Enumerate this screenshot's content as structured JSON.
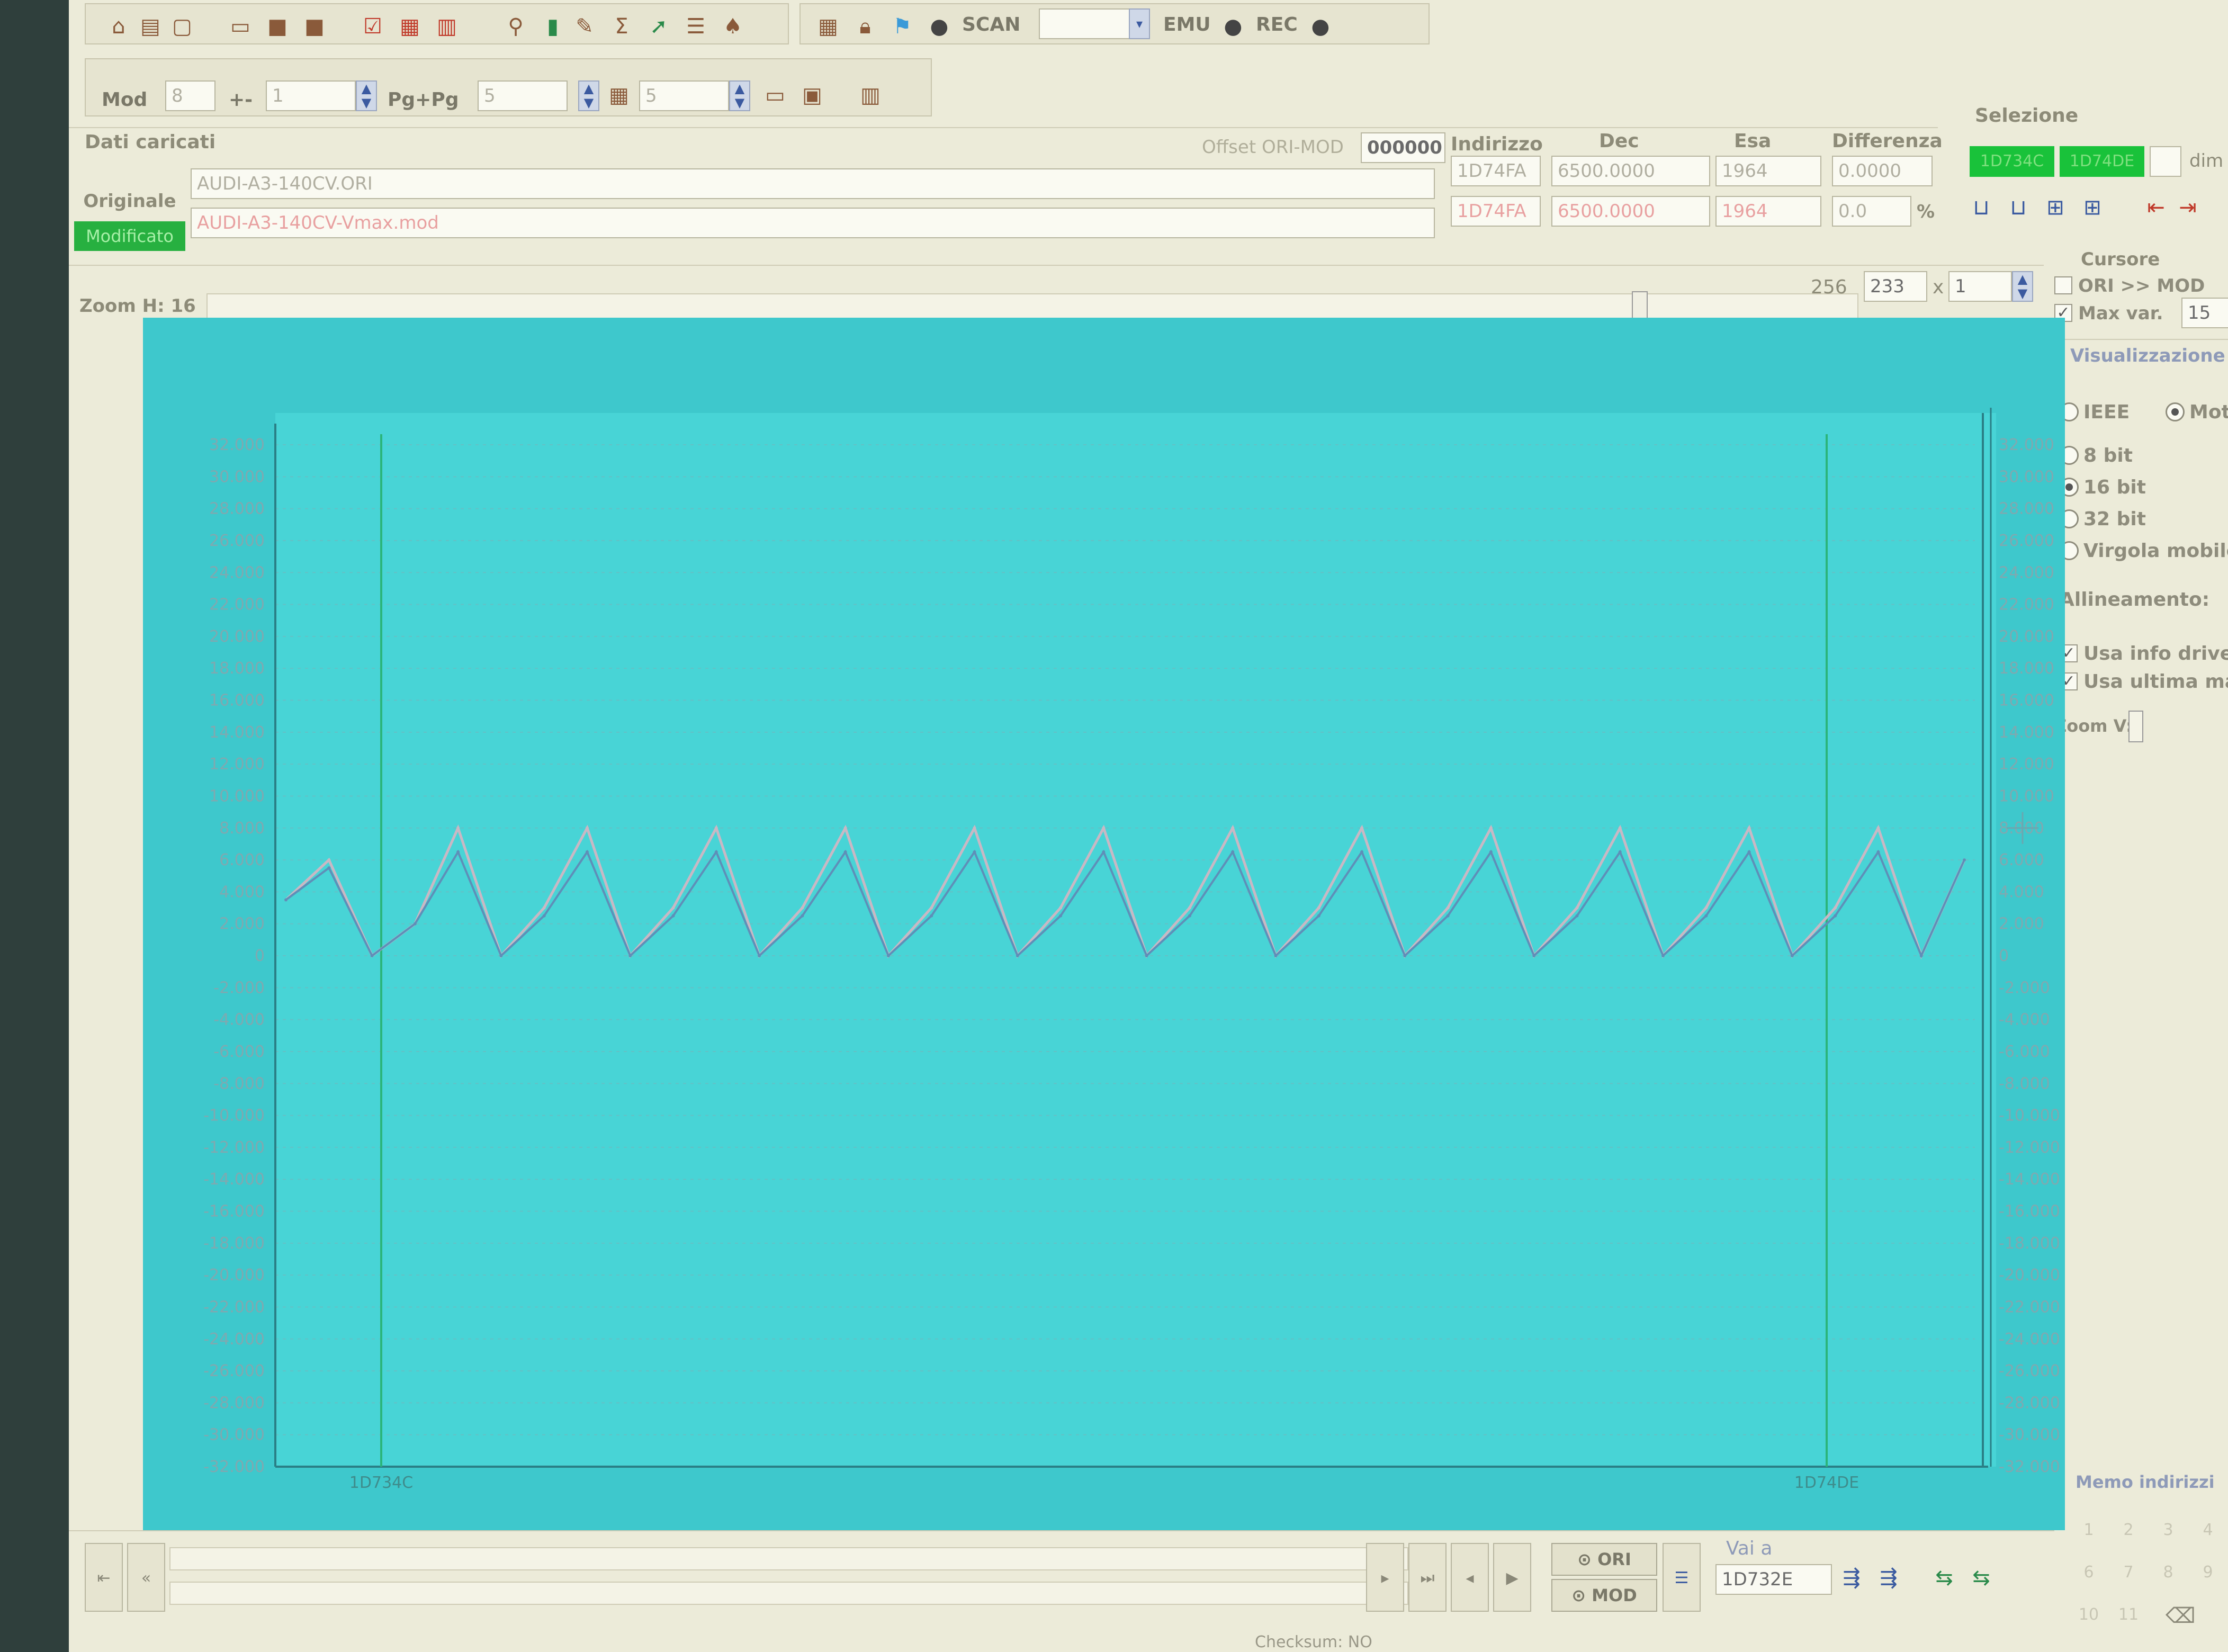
{
  "toolbar": {
    "scan_label": "SCAN",
    "emu_label": "EMU",
    "rec_label": "REC"
  },
  "toolbar2": {
    "mod_label": "Mod",
    "mod_value": "8",
    "plusminus_label": "+-",
    "plusminus_value": "1",
    "pg_label": "Pg+Pg",
    "pg_value": "5",
    "step_value": "5"
  },
  "loaded_data": {
    "title": "Dati caricati",
    "offset_label": "Offset ORI-MOD",
    "offset_value": "000000",
    "col_address": "Indirizzo",
    "col_dec": "Dec",
    "col_hex": "Esa",
    "col_diff": "Differenza",
    "original": {
      "label": "Originale",
      "file": "AUDI-A3-140CV.ORI",
      "address": "1D74FA",
      "dec": "6500.0000",
      "hex": "1964",
      "diff": "0.0000"
    },
    "modified": {
      "label": "Modificato",
      "file": "AUDI-A3-140CV-Vmax.mod",
      "address": "1D74FA",
      "dec": "6500.0000",
      "hex": "1964",
      "diff": "0.0",
      "diff_unit": "%"
    }
  },
  "selection": {
    "title": "Selezione",
    "from": "1D734C",
    "to": "1D74DE",
    "dim_label": "dim"
  },
  "zoom_h": {
    "label": "Zoom H: 16",
    "max": "256",
    "value": "233",
    "times": "x",
    "multiplier": "1"
  },
  "cursor": {
    "title": "Cursore",
    "ori_mod_label": "ORI >> MOD",
    "ori_mod_checked": false,
    "max_var_label": "Max var.",
    "max_var_checked": true,
    "max_var_value": "15"
  },
  "display": {
    "title": "Visualizzazione",
    "ieee": "IEEE",
    "mot": "Mot",
    "bit8": "8 bit",
    "bit16": "16 bit",
    "bit32": "32 bit",
    "float": "Virgola mobile",
    "selected_bits": "16 bit",
    "alignment_label": "Allineamento:",
    "use_driver_info": "Usa info drive",
    "use_last": "Usa ultima ma",
    "zoom_v_label": "Zoom V:"
  },
  "memo": {
    "title": "Memo indirizzi",
    "cells": [
      "1",
      "2",
      "3",
      "4",
      "6",
      "7",
      "8",
      "9",
      "10",
      "11"
    ]
  },
  "bottom": {
    "ori_button": "ORI",
    "mod_button": "MOD",
    "goto_label": "Vai a",
    "goto_value": "1D732E",
    "checksum": "Checksum: NO"
  },
  "colors": {
    "plot_bg": "#3ec8cc",
    "plot_inner": "#48d4d6",
    "grid": "#6fb9c0",
    "series_ori": "#c9b8c4",
    "series_mod": "#5e8fb8",
    "marker": "#2bb57a",
    "selected_green": "#19c23a"
  },
  "chart_data": {
    "type": "line",
    "ylim": [
      -32000,
      32000
    ],
    "yticks_left": [
      "32.000",
      "30.000",
      "28.000",
      "26.000",
      "24.000",
      "22.000",
      "20.000",
      "18.000",
      "16.000",
      "14.000",
      "12.000",
      "10.000",
      "8.000",
      "6.000",
      "4.000",
      "2.000",
      "0",
      "-2.000",
      "-4.000",
      "-6.000",
      "-8.000",
      "-10.000",
      "-12.000",
      "-14.000",
      "-16.000",
      "-18.000",
      "-20.000",
      "-22.000",
      "-24.000",
      "-26.000",
      "-28.000",
      "-30.000",
      "-32.000"
    ],
    "yticks_right": [
      "32.000",
      "30.000",
      "28.000",
      "26.000",
      "24.000",
      "22.000",
      "20.000",
      "18.000",
      "16.000",
      "14.000",
      "12.000",
      "10.000",
      "8.000",
      "6.000",
      "4.000",
      "2.000",
      "0",
      "-2.000",
      "-4.000",
      "-6.000",
      "-8.000",
      "-10.000",
      "-12.000",
      "-14.000",
      "-16.000",
      "-18.000",
      "-20.000",
      "-22.000",
      "-24.000",
      "-26.000",
      "-28.000",
      "-30.000",
      "-32.000"
    ],
    "x_marker_labels": [
      "1D734C",
      "1D74DE"
    ],
    "series": [
      {
        "points": [
          [
            0,
            3500
          ],
          [
            1,
            6000
          ],
          [
            2,
            0
          ],
          [
            3,
            2000
          ],
          [
            4,
            8000
          ],
          [
            5,
            0
          ],
          [
            6,
            3000
          ],
          [
            7,
            8000
          ],
          [
            8,
            0
          ],
          [
            9,
            3000
          ],
          [
            10,
            8000
          ],
          [
            11,
            0
          ],
          [
            12,
            3000
          ],
          [
            13,
            8000
          ],
          [
            14,
            0
          ],
          [
            15,
            3000
          ],
          [
            16,
            8000
          ],
          [
            17,
            0
          ],
          [
            18,
            3000
          ],
          [
            19,
            8000
          ],
          [
            20,
            0
          ],
          [
            21,
            3000
          ],
          [
            22,
            8000
          ],
          [
            23,
            0
          ],
          [
            24,
            3000
          ],
          [
            25,
            8000
          ],
          [
            26,
            0
          ],
          [
            27,
            3000
          ],
          [
            28,
            8000
          ],
          [
            29,
            0
          ],
          [
            30,
            3000
          ],
          [
            31,
            8000
          ],
          [
            32,
            0
          ],
          [
            33,
            3000
          ],
          [
            34,
            8000
          ],
          [
            35,
            0
          ],
          [
            36,
            3000
          ],
          [
            37,
            8000
          ],
          [
            38,
            0
          ],
          [
            39,
            6000
          ]
        ]
      },
      {
        "points": [
          [
            0,
            3500
          ],
          [
            1,
            5500
          ],
          [
            2,
            0
          ],
          [
            3,
            2000
          ],
          [
            4,
            6500
          ],
          [
            5,
            0
          ],
          [
            6,
            2500
          ],
          [
            7,
            6500
          ],
          [
            8,
            0
          ],
          [
            9,
            2500
          ],
          [
            10,
            6500
          ],
          [
            11,
            0
          ],
          [
            12,
            2500
          ],
          [
            13,
            6500
          ],
          [
            14,
            0
          ],
          [
            15,
            2500
          ],
          [
            16,
            6500
          ],
          [
            17,
            0
          ],
          [
            18,
            2500
          ],
          [
            19,
            6500
          ],
          [
            20,
            0
          ],
          [
            21,
            2500
          ],
          [
            22,
            6500
          ],
          [
            23,
            0
          ],
          [
            24,
            2500
          ],
          [
            25,
            6500
          ],
          [
            26,
            0
          ],
          [
            27,
            2500
          ],
          [
            28,
            6500
          ],
          [
            29,
            0
          ],
          [
            30,
            2500
          ],
          [
            31,
            6500
          ],
          [
            32,
            0
          ],
          [
            33,
            2500
          ],
          [
            34,
            6500
          ],
          [
            35,
            0
          ],
          [
            36,
            2500
          ],
          [
            37,
            6500
          ],
          [
            38,
            0
          ],
          [
            39,
            6000
          ]
        ]
      }
    ],
    "grid": true
  }
}
